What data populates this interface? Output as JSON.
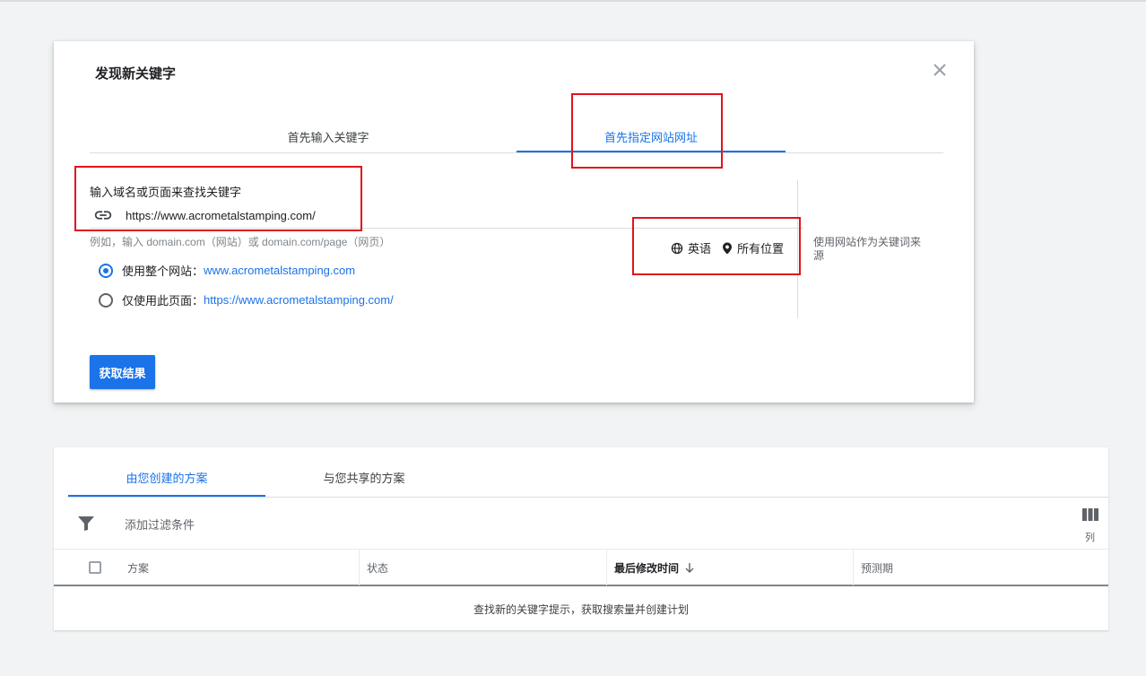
{
  "dialog": {
    "title": "发现新关键字",
    "tabs": [
      {
        "label": "首先输入关键字"
      },
      {
        "label": "首先指定网站网址"
      }
    ],
    "input_label": "输入域名或页面来查找关键字",
    "url_value": "https://www.acrometalstamping.com/",
    "hint": "例如，输入 domain.com（网站）或 domain.com/page（网页）",
    "language": "英语",
    "location": "所有位置",
    "side_note": "使用网站作为关键词来源",
    "options": [
      {
        "label": "使用整个网站：",
        "value": "www.acrometalstamping.com",
        "checked": true
      },
      {
        "label": "仅使用此页面：",
        "value": "https://www.acrometalstamping.com/",
        "checked": false
      }
    ],
    "submit_label": "获取结果"
  },
  "plans": {
    "tabs": [
      {
        "label": "由您创建的方案"
      },
      {
        "label": "与您共享的方案"
      }
    ],
    "filter_label": "添加过滤条件",
    "columns_label": "列",
    "headers": [
      "方案",
      "状态",
      "最后修改时间",
      "预测期"
    ],
    "empty_text": "查找新的关键字提示，获取搜索量并创建计划"
  },
  "colors": {
    "accent": "#1a73e8",
    "annotation": "#e0141c",
    "background": "#f1f3f4"
  },
  "icons": [
    "close-icon",
    "link-icon",
    "globe-icon",
    "location-pin-icon",
    "filter-icon",
    "columns-icon",
    "arrow-down-icon"
  ]
}
